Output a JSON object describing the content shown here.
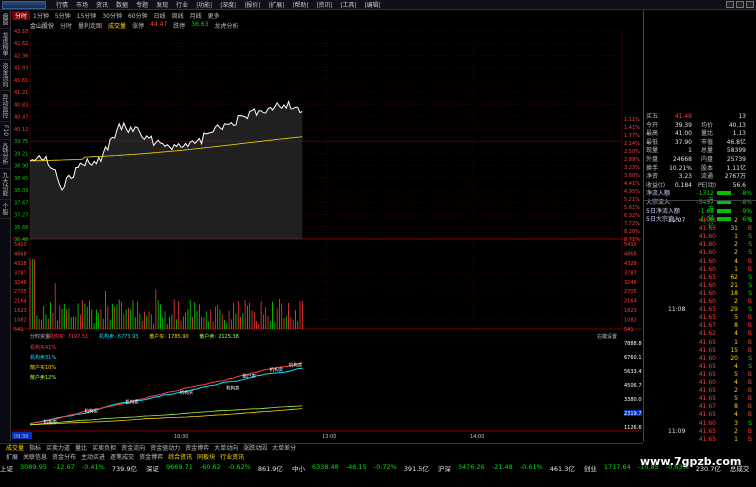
{
  "menu": [
    "行情",
    "市场",
    "资讯",
    "数据",
    "专题",
    "发现",
    "行业",
    "|功能|",
    "|深度|",
    "|报价|",
    "|扩展|",
    "|帮助|",
    "|资讯|",
    "|工具|",
    "|编辑|"
  ],
  "left_tabs": [
    "盘面",
    "龙虎榜单",
    "资金流向",
    "异动监控",
    "F10",
    "K线分析",
    "九大功能",
    "个股"
  ],
  "periods": [
    "分时",
    "1分钟",
    "5分钟",
    "15分钟",
    "30分钟",
    "60分钟",
    "日线",
    "周线",
    "月线",
    "更多"
  ],
  "chart_title": {
    "stock": "金山股份",
    "tag1": "分时",
    "tag2": "量利走图",
    "tag3": "成交量",
    "price_label": "涨停",
    "price": "44.47",
    "change_label": "跌停",
    "change": "36.63",
    "vol_label": "龙虎分析"
  },
  "price_axis_left": [
    "43.18",
    "42.62",
    "42.36",
    "41.93",
    "41.61",
    "41.21",
    "40.83",
    "40.47",
    "40.12",
    "39.75",
    "39.21",
    "38.90",
    "38.45",
    "38.09",
    "37.67",
    "37.27",
    "36.68",
    "36.48"
  ],
  "pct_axis_right": [
    "1.11%",
    "1.41%",
    "1.77%",
    "2.14%",
    "2.50%",
    "2.89%",
    "3.23%",
    "3.60%",
    "4.41%",
    "4.95%",
    "5.21%",
    "5.61%",
    "6.32%",
    "7.72%",
    "8.20%",
    "8.71%"
  ],
  "vol_axis_left": [
    "5410",
    "4868",
    "4328",
    "3787",
    "3246",
    "2705",
    "2164",
    "1623",
    "1082",
    "541"
  ],
  "vol_axis_right": [
    "5410",
    "4868",
    "4328",
    "3787",
    "3246",
    "2705",
    "2164",
    "1623",
    "1082",
    "541"
  ],
  "flow_header": {
    "label": "分时资金",
    "a_label": "机构买:",
    "a_val": "7197.51",
    "b_label": "机构卖:",
    "b_val": "6773.93",
    "c_label": "散户买:",
    "c_val": "1785.90",
    "d_label": "散户卖:",
    "d_val": "2125.38",
    "settings": "右键设置"
  },
  "flow_legend": [
    {
      "label": "机构买41%",
      "color": "#ff3c3c"
    },
    {
      "label": "机构卖31%",
      "color": "#00e0ff"
    },
    {
      "label": "散户买10%",
      "color": "#ffd700"
    },
    {
      "label": "散户卖12%",
      "color": "#a0ff50"
    }
  ],
  "flow_axis_right": [
    "7888.86",
    "6760.17",
    "5633.47",
    "4506.78",
    "3380.08",
    "2319.73",
    "1126.69"
  ],
  "time_axis": [
    "09:30",
    "10:30",
    "13:00",
    "14:00"
  ],
  "flow_tags": [
    "机构卖",
    "机构买",
    "机构卖",
    "机构买",
    "机构卖",
    "散户卖",
    "机构卖",
    "机构卖"
  ],
  "right_panel": {
    "top": [
      {
        "l": "买五",
        "v1": "41.48",
        "v2": "13"
      },
      {
        "l": "今开",
        "v1": "39.39",
        "m": "均价",
        "v2": "40.13"
      },
      {
        "l": "最高",
        "v1": "41.00",
        "m": "量比",
        "v2": "1.13"
      },
      {
        "l": "最低",
        "v1": "37.90",
        "m": "市值",
        "v2": "46.8亿"
      },
      {
        "l": "现量",
        "v1": "1",
        "m": "总量",
        "v2": "58399"
      },
      {
        "l": "外盘",
        "v1": "24668",
        "m": "内盘",
        "v2": "25739"
      },
      {
        "l": "换手",
        "v1": "10.21%",
        "m": "股本",
        "v2": "1.11亿"
      },
      {
        "l": "净资",
        "v1": "3.23",
        "m": "流通",
        "v2": "2767万"
      },
      {
        "l": "收益(t)",
        "v1": "0.184",
        "m": "PE(动)",
        "v2": "56.6"
      },
      {
        "l": "净流入额",
        "v1": "-1312万",
        "v2": "-8%"
      },
      {
        "l": "大宗流入",
        "v1": "-5457万",
        "v2": "-8%"
      },
      {
        "l": "5日净流入额",
        "v1": "-1.66亿",
        "v2": "-9%"
      },
      {
        "l": "5日大宗流入",
        "v1": "-1.08亿",
        "v2": "-6%"
      }
    ],
    "trades": [
      {
        "t": "11:07",
        "p": "41.63",
        "v": "2",
        "n": "S"
      },
      {
        "t": "",
        "p": "41.63",
        "v": "31",
        "n": "B"
      },
      {
        "t": "",
        "p": "41.60",
        "v": "1",
        "n": "S"
      },
      {
        "t": "",
        "p": "41.80",
        "v": "2",
        "n": "S"
      },
      {
        "t": "",
        "p": "41.60",
        "v": "2",
        "n": "S"
      },
      {
        "t": "",
        "p": "41.60",
        "v": "4",
        "n": "B"
      },
      {
        "t": "",
        "p": "41.60",
        "v": "1",
        "n": "B"
      },
      {
        "t": "",
        "p": "41.65",
        "v": "62",
        "n": "S"
      },
      {
        "t": "",
        "p": "41.60",
        "v": "21",
        "n": "S"
      },
      {
        "t": "",
        "p": "41.60",
        "v": "18",
        "n": "S"
      },
      {
        "t": "",
        "p": "41.60",
        "v": "2",
        "n": "B"
      },
      {
        "t": "11:08",
        "p": "41.65",
        "v": "29",
        "n": "S"
      },
      {
        "t": "",
        "p": "41.65",
        "v": "5",
        "n": "B"
      },
      {
        "t": "",
        "p": "41.67",
        "v": "8",
        "n": "B"
      },
      {
        "t": "",
        "p": "41.62",
        "v": "4",
        "n": "B"
      },
      {
        "t": "",
        "p": "41.65",
        "v": "1",
        "n": "B"
      },
      {
        "t": "",
        "p": "41.65",
        "v": "15",
        "n": "B"
      },
      {
        "t": "",
        "p": "41.60",
        "v": "20",
        "n": "S"
      },
      {
        "t": "",
        "p": "41.65",
        "v": "4",
        "n": "S"
      },
      {
        "t": "",
        "p": "41.65",
        "v": "5",
        "n": "B"
      },
      {
        "t": "",
        "p": "41.60",
        "v": "4",
        "n": "B"
      },
      {
        "t": "",
        "p": "41.65",
        "v": "2",
        "n": "B"
      },
      {
        "t": "",
        "p": "41.65",
        "v": "5",
        "n": "B"
      },
      {
        "t": "",
        "p": "41.67",
        "v": "8",
        "n": "B"
      },
      {
        "t": "",
        "p": "41.65",
        "v": "4",
        "n": "B"
      },
      {
        "t": "",
        "p": "41.60",
        "v": "3",
        "n": "S"
      },
      {
        "t": "11:09",
        "p": "41.65",
        "v": "2",
        "n": "B"
      },
      {
        "t": "",
        "p": "41.65",
        "v": "1",
        "n": "B"
      }
    ]
  },
  "tabs": [
    "成交量",
    "指标",
    "买卖力道",
    "量比",
    "买卖负担",
    "资金流向",
    "资金驱动力",
    "资金博弈",
    "大单动向",
    "涨跌动因",
    "大单差分"
  ],
  "tabs2": [
    "扩展",
    "关联信息",
    "资金分布",
    "主动买进",
    "逐笔成交",
    "资金博弈",
    "综合资讯",
    "同板块",
    "行业资讯"
  ],
  "ticker": [
    {
      "name": "上证",
      "v": "3089.95",
      "c": "-12.67",
      "p": "-0.41%",
      "a": "739.9亿"
    },
    {
      "name": "深证",
      "v": "9669.71",
      "c": "-60.62",
      "p": "-0.62%",
      "a": "861.9亿"
    },
    {
      "name": "中小",
      "v": "6338.48",
      "c": "-46.15",
      "p": "-0.72%",
      "a": "391.5亿"
    },
    {
      "name": "沪深",
      "v": "3476.26",
      "c": "-21.48",
      "p": "-0.61%",
      "a": "461.3亿"
    },
    {
      "name": "创业",
      "v": "1717.64",
      "c": "-10.85",
      "p": "-0.63%",
      "a": "230.7亿"
    },
    {
      "name": "总成交",
      "v": "1602亿",
      "c": "",
      "p": "",
      "a": "杭州联通"
    }
  ],
  "watermark": "www.7gpzb.com",
  "colors": {
    "up": "#ff3c3c",
    "down": "#00e000",
    "price_line": "#ffffff",
    "avg_line": "#ffd700",
    "grid": "#7a0000"
  }
}
